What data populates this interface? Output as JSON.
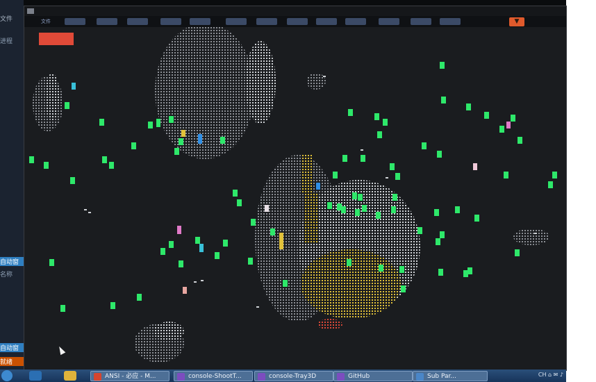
{
  "window": {
    "title": "",
    "menu": [
      "文件",
      "",
      "",
      "",
      "",
      "",
      "",
      "",
      "",
      "",
      "",
      "",
      "",
      ""
    ]
  },
  "filter_icon": "filter-icon",
  "side": {
    "top_label": "文件",
    "mid_label": "进程",
    "auto1": "自动窗",
    "name": "名称",
    "auto2": "自动窗",
    "status": "就绪"
  },
  "game": {
    "colors": {
      "background": "#1a1c1f",
      "asteroid": "#cfd2d6",
      "dim_asteroid": "#8d9096",
      "green": "#2ee86a",
      "yellow": "#e2c23a",
      "red": "#e04a38",
      "blue": "#2f8fe6",
      "cyan": "#39c0d8",
      "pink": "#e07ac8"
    },
    "health_bar_color": "#e04a38"
  },
  "taskbar": {
    "items": [
      {
        "label": "ANSI - 必应 - M...",
        "icon": "edge-icon"
      },
      {
        "label": "console-ShootT...",
        "icon": "visual-studio-icon"
      },
      {
        "label": "console-Tray3D",
        "icon": "visual-studio-icon"
      },
      {
        "label": "GitHub",
        "icon": "github-icon"
      },
      {
        "label": "Sub Par...",
        "icon": "app-icon"
      }
    ],
    "tray_text": "CH ⌂ ✉ ♪"
  }
}
